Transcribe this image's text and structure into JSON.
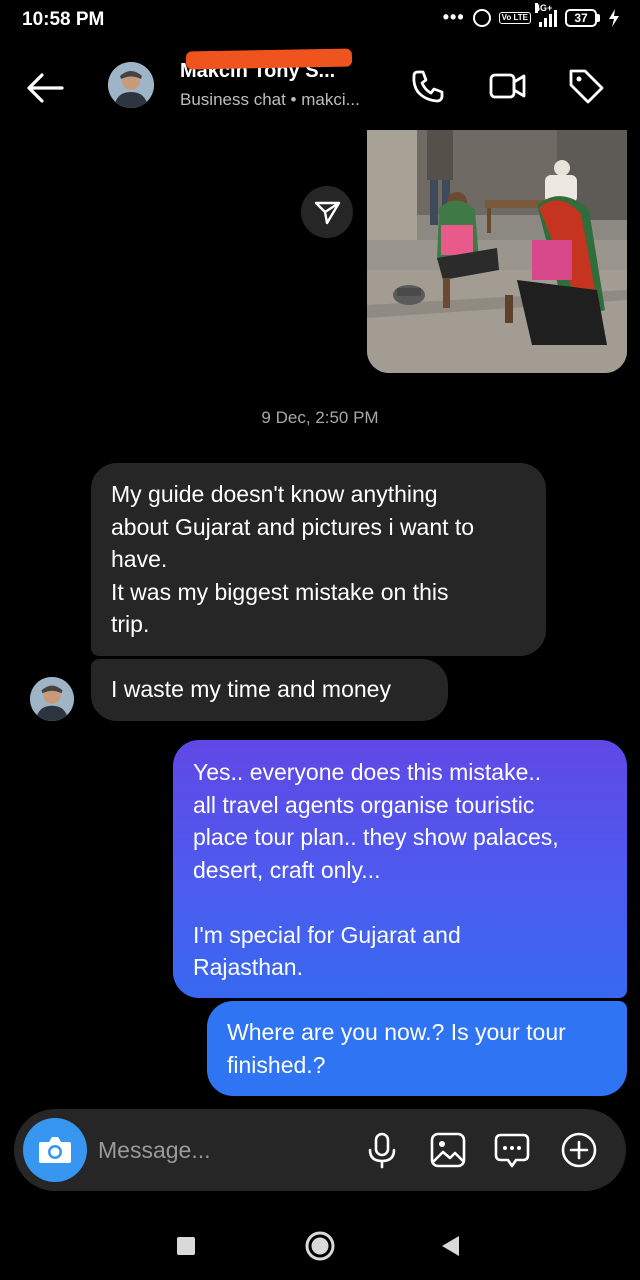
{
  "status_bar": {
    "time": "10:58 PM",
    "network": "4G+",
    "volte": "Vo LTE",
    "battery": "37"
  },
  "header": {
    "contact_name": "Makcin Tony S...",
    "subtitle": "Business chat • makci..."
  },
  "messages": {
    "timestamp": "9 Dec, 2:50 PM",
    "incoming_1": [
      "My guide doesn't know anything",
      "about Gujarat and pictures i want to",
      "have.",
      "It was my biggest mistake on this",
      "trip."
    ],
    "incoming_2": "I waste my time and money",
    "outgoing_1": [
      "Yes.. everyone does this mistake..",
      "all travel agents organise touristic",
      "place tour plan.. they show palaces,",
      "desert, craft only...",
      "",
      "I'm special for Gujarat and",
      "Rajasthan."
    ],
    "outgoing_2": [
      "Where are you now.? Is your tour",
      "finished.?"
    ]
  },
  "composer": {
    "placeholder": "Message..."
  },
  "icons": {
    "back": "arrow-left-icon",
    "call": "phone-icon",
    "video": "video-camera-icon",
    "tag": "tag-icon",
    "share": "send-icon",
    "camera": "camera-icon",
    "mic": "microphone-icon",
    "gallery": "image-icon",
    "sticker": "chat-bubble-icon",
    "plus": "plus-circle-icon"
  },
  "colors": {
    "background": "#000000",
    "incoming_bubble": "#262626",
    "outgoing_gradient_top": "#5f48e6",
    "outgoing_gradient_bottom": "#2f74f2",
    "camera_button": "#3797f0",
    "redaction": "#f0541e"
  }
}
